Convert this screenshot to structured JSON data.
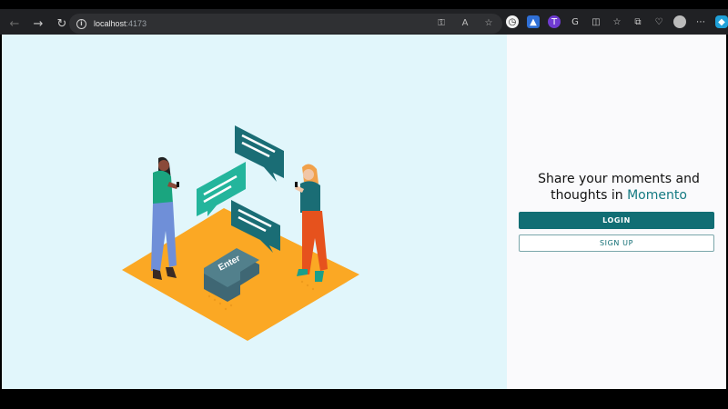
{
  "browser": {
    "nav": {
      "back_icon": "arrow-left-icon",
      "forward_icon": "arrow-right-icon",
      "reload_icon": "reload-icon"
    },
    "url_host": "localhost",
    "url_port": ":4173",
    "address_icons": [
      "key-icon",
      "read-aloud-icon",
      "star-icon"
    ],
    "extension_icons": [
      "clock-extension-icon",
      "bot-extension-icon",
      "t-extension-icon",
      "g-extension-icon",
      "split-screen-icon",
      "favorites-icon",
      "collections-icon",
      "heart-pulse-icon",
      "profile-avatar",
      "menu-icon",
      "copilot-icon"
    ]
  },
  "hero": {
    "illustration": "two people texting on isometric orange floor with chat bubbles and Enter key",
    "enter_key_label": "Enter"
  },
  "auth": {
    "tagline_prefix": "Share your moments and thoughts in ",
    "brand": "Momento",
    "login_label": "LOGIN",
    "signup_label": "SIGN UP"
  },
  "colors": {
    "hero_bg": "#e1f6fb",
    "floor": "#fba824",
    "accent_teal": "#116e74",
    "bubble_green": "#23b59c",
    "page_bg": "#fafafc"
  }
}
